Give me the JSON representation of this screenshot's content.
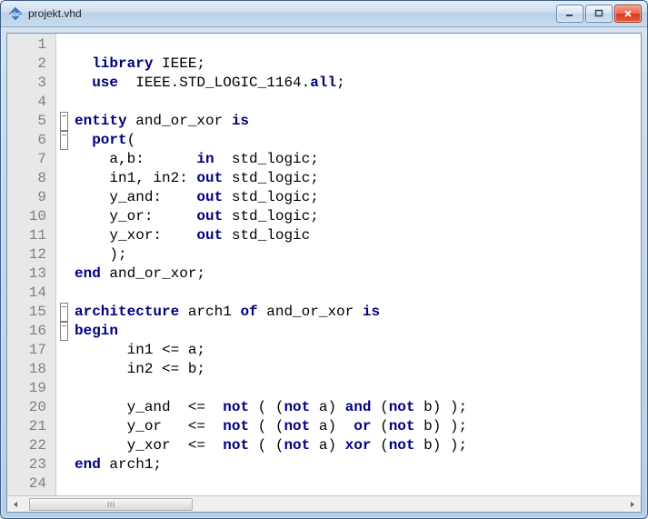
{
  "window": {
    "title": "projekt.vhd"
  },
  "editor": {
    "line_count": 24,
    "fold_lines": [
      5,
      6,
      15,
      16
    ],
    "lines": [
      {
        "n": 1,
        "tokens": []
      },
      {
        "n": 2,
        "tokens": [
          {
            "t": "  ",
            "c": ""
          },
          {
            "t": "library",
            "c": "kw"
          },
          {
            "t": " IEEE;",
            "c": ""
          }
        ]
      },
      {
        "n": 3,
        "tokens": [
          {
            "t": "  ",
            "c": ""
          },
          {
            "t": "use",
            "c": "kw"
          },
          {
            "t": "  IEEE.STD_LOGIC_1164.",
            "c": ""
          },
          {
            "t": "all",
            "c": "kw"
          },
          {
            "t": ";",
            "c": ""
          }
        ]
      },
      {
        "n": 4,
        "tokens": []
      },
      {
        "n": 5,
        "tokens": [
          {
            "t": "entity",
            "c": "kw"
          },
          {
            "t": " and_or_xor ",
            "c": ""
          },
          {
            "t": "is",
            "c": "kw"
          }
        ]
      },
      {
        "n": 6,
        "tokens": [
          {
            "t": "  ",
            "c": ""
          },
          {
            "t": "port",
            "c": "kw"
          },
          {
            "t": "(",
            "c": ""
          }
        ]
      },
      {
        "n": 7,
        "tokens": [
          {
            "t": "    a,b:      ",
            "c": ""
          },
          {
            "t": "in",
            "c": "kw"
          },
          {
            "t": "  std_logic;",
            "c": ""
          }
        ]
      },
      {
        "n": 8,
        "tokens": [
          {
            "t": "    in1, in2: ",
            "c": ""
          },
          {
            "t": "out",
            "c": "kw"
          },
          {
            "t": " std_logic;",
            "c": ""
          }
        ]
      },
      {
        "n": 9,
        "tokens": [
          {
            "t": "    y_and:    ",
            "c": ""
          },
          {
            "t": "out",
            "c": "kw"
          },
          {
            "t": " std_logic;",
            "c": ""
          }
        ]
      },
      {
        "n": 10,
        "tokens": [
          {
            "t": "    y_or:     ",
            "c": ""
          },
          {
            "t": "out",
            "c": "kw"
          },
          {
            "t": " std_logic;",
            "c": ""
          }
        ]
      },
      {
        "n": 11,
        "tokens": [
          {
            "t": "    y_xor:    ",
            "c": ""
          },
          {
            "t": "out",
            "c": "kw"
          },
          {
            "t": " std_logic",
            "c": ""
          }
        ]
      },
      {
        "n": 12,
        "tokens": [
          {
            "t": "    );",
            "c": ""
          }
        ]
      },
      {
        "n": 13,
        "tokens": [
          {
            "t": "end",
            "c": "kw"
          },
          {
            "t": " and_or_xor;",
            "c": ""
          }
        ]
      },
      {
        "n": 14,
        "tokens": []
      },
      {
        "n": 15,
        "tokens": [
          {
            "t": "architecture",
            "c": "kw"
          },
          {
            "t": " arch1 ",
            "c": ""
          },
          {
            "t": "of",
            "c": "kw"
          },
          {
            "t": " and_or_xor ",
            "c": ""
          },
          {
            "t": "is",
            "c": "kw"
          }
        ]
      },
      {
        "n": 16,
        "tokens": [
          {
            "t": "begin",
            "c": "kw"
          }
        ]
      },
      {
        "n": 17,
        "tokens": [
          {
            "t": "      in1 <= a;",
            "c": ""
          }
        ]
      },
      {
        "n": 18,
        "tokens": [
          {
            "t": "      in2 <= b;",
            "c": ""
          }
        ]
      },
      {
        "n": 19,
        "tokens": []
      },
      {
        "n": 20,
        "tokens": [
          {
            "t": "      y_and  <=  ",
            "c": ""
          },
          {
            "t": "not",
            "c": "kw"
          },
          {
            "t": " ( (",
            "c": ""
          },
          {
            "t": "not",
            "c": "kw"
          },
          {
            "t": " a) ",
            "c": ""
          },
          {
            "t": "and",
            "c": "kw"
          },
          {
            "t": " (",
            "c": ""
          },
          {
            "t": "not",
            "c": "kw"
          },
          {
            "t": " b) );",
            "c": ""
          }
        ]
      },
      {
        "n": 21,
        "tokens": [
          {
            "t": "      y_or   <=  ",
            "c": ""
          },
          {
            "t": "not",
            "c": "kw"
          },
          {
            "t": " ( (",
            "c": ""
          },
          {
            "t": "not",
            "c": "kw"
          },
          {
            "t": " a)  ",
            "c": ""
          },
          {
            "t": "or",
            "c": "kw"
          },
          {
            "t": " (",
            "c": ""
          },
          {
            "t": "not",
            "c": "kw"
          },
          {
            "t": " b) );",
            "c": ""
          }
        ]
      },
      {
        "n": 22,
        "tokens": [
          {
            "t": "      y_xor  <=  ",
            "c": ""
          },
          {
            "t": "not",
            "c": "kw"
          },
          {
            "t": " ( (",
            "c": ""
          },
          {
            "t": "not",
            "c": "kw"
          },
          {
            "t": " a) ",
            "c": ""
          },
          {
            "t": "xor",
            "c": "kw"
          },
          {
            "t": " (",
            "c": ""
          },
          {
            "t": "not",
            "c": "kw"
          },
          {
            "t": " b) );",
            "c": ""
          }
        ]
      },
      {
        "n": 23,
        "tokens": [
          {
            "t": "end",
            "c": "kw"
          },
          {
            "t": " arch1;",
            "c": ""
          }
        ]
      },
      {
        "n": 24,
        "tokens": []
      }
    ]
  }
}
